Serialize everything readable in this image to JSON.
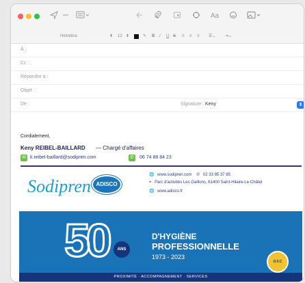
{
  "toolbar": {
    "icons": [
      "send-icon",
      "reply-icon",
      "header-fields-icon",
      "back-icon",
      "attach-icon",
      "attachment-view-icon",
      "markup-icon",
      "format-icon",
      "emoji-icon",
      "photo-browser-icon"
    ]
  },
  "format_bar": {
    "font": "Helvetica",
    "size": "12",
    "bold": "B",
    "italic": "I",
    "underline": "U",
    "strike": "S"
  },
  "fields": {
    "to_label": "À :",
    "cc_label": "Cc :",
    "reply_to_label": "Répondre à :",
    "subject_label": "Objet :",
    "from_label": "De :",
    "signature_label": "Signature :",
    "signature_value": "Keny"
  },
  "body": {
    "greeting": "Cordialement,",
    "name": "Keny REIBEL-BAILLARD",
    "role": "— Chargé d'affaires",
    "email": "k.reibel-baillard@sodipren.com",
    "phone": "06 74 88 84 23"
  },
  "company": {
    "logo_text": "Sodipren",
    "logo_badge": "ADISCO",
    "website": "www.sodipren.com",
    "phone": "02 33 85 37 85",
    "address": "Parc d'activités Les Gaillons, 61400 Saint-Hilaire-Le-Châtel",
    "website2": "www.adisco.fr"
  },
  "banner": {
    "big_number": "50",
    "ans": "ANS",
    "title1": "D'HYGIÈNE",
    "title2": "PROFESSIONNELLE",
    "years": "1973 - 2023",
    "seal": "O.F.C",
    "footer": "PROXIMITÉ  ·  ACCOMPAGNEMENT  ·  SERVICES"
  },
  "colors": {
    "close": "#ff5f57",
    "minimize": "#febc2e",
    "zoom": "#28c840",
    "accent": "#2a7cf0",
    "banner": "#1a73b6",
    "banner_dark": "#16347c"
  }
}
